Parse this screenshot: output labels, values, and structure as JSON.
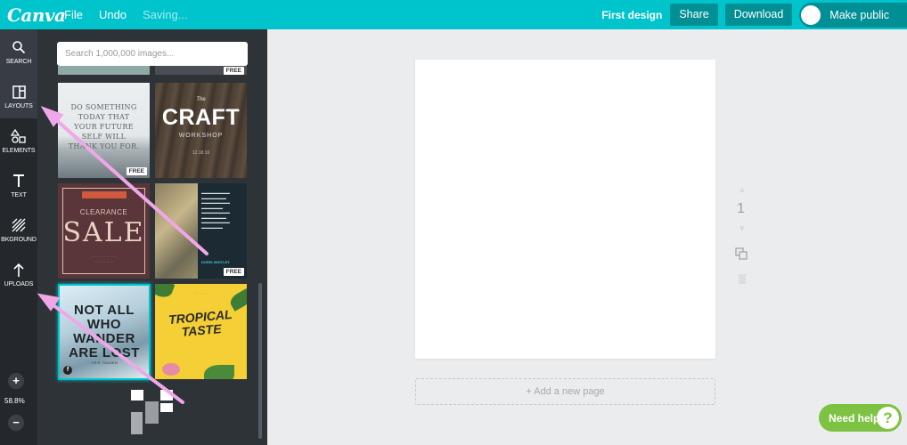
{
  "topbar": {
    "logo": "Canva",
    "file": "File",
    "undo": "Undo",
    "saving": "Saving...",
    "design_title": "First design",
    "share": "Share",
    "download": "Download",
    "make_public": "Make public"
  },
  "sidebar": {
    "items": [
      {
        "label": "SEARCH",
        "icon": "search-icon"
      },
      {
        "label": "LAYOUTS",
        "icon": "layouts-icon"
      },
      {
        "label": "ELEMENTS",
        "icon": "elements-icon"
      },
      {
        "label": "TEXT",
        "icon": "text-icon"
      },
      {
        "label": "BKGROUND",
        "icon": "background-icon"
      },
      {
        "label": "UPLOADS",
        "icon": "upload-icon"
      }
    ],
    "zoom_in": "+",
    "zoom_out": "−",
    "zoom_level": "58.8%"
  },
  "panel": {
    "search_placeholder": "Search 1,000,000 images...",
    "free_badge": "FREE",
    "tiles": {
      "quote": {
        "text": "DO SOMETHING TODAY THAT YOUR FUTURE SELF WILL THANK YOU FOR."
      },
      "craft": {
        "pre": "The",
        "title": "CRAFT",
        "sub": "WORKSHOP",
        "date": "12.18.16"
      },
      "sale": {
        "top": "CLEARANCE",
        "title": "SALE"
      },
      "quote2": {
        "author": "DORIS WHITLEY"
      },
      "wander": {
        "text": "NOT ALL WHO WANDER ARE LOST",
        "author": "J.R.R. TOLKIEN"
      },
      "tropical": {
        "text": "TROPICAL TASTE"
      }
    }
  },
  "canvas": {
    "page_number": "1",
    "add_page": "+ Add a new page"
  },
  "help": {
    "label": "Need help",
    "icon_text": "?"
  },
  "colors": {
    "brand": "#00c4cc",
    "button": "#008f95",
    "sidebar": "#24282d",
    "panel": "#2e3338",
    "help": "#7dc242",
    "annotation_arrow": "#f0a7e8"
  }
}
